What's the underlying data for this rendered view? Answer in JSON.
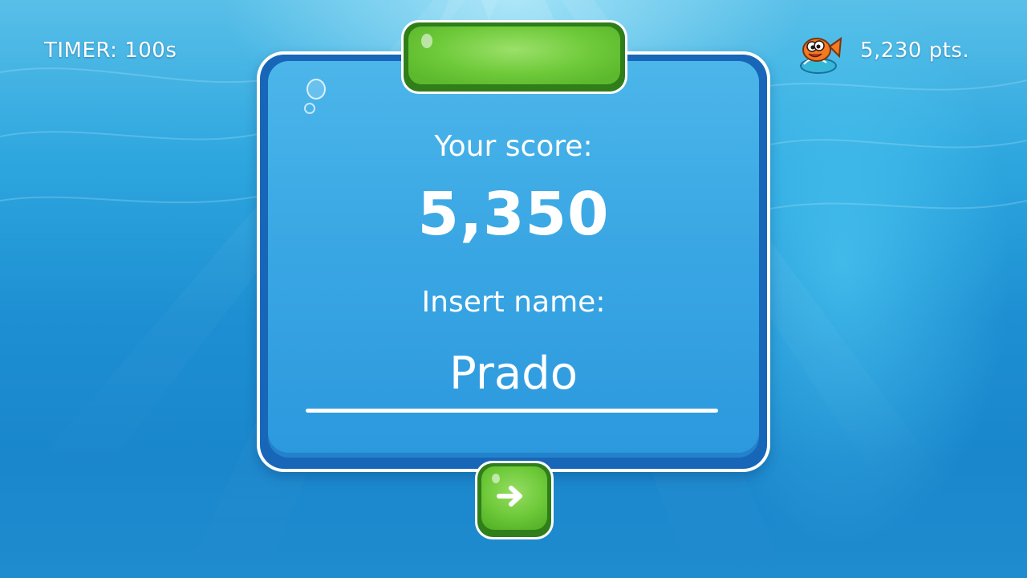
{
  "hud": {
    "timer_text": "TIMER: 100s",
    "points_text": "5,230 pts.",
    "points_icon": "fish-icon"
  },
  "dialog": {
    "score_label": "Your score:",
    "score_value": "5,350",
    "name_label": "Insert name:",
    "name_value": "Prado",
    "next_icon": "arrow-right-icon"
  },
  "colors": {
    "panel_blue": "#3aa7e4",
    "panel_border": "#1766b8",
    "button_green": "#6fca3a",
    "button_green_border": "#2f7e1a",
    "text": "#ffffff"
  }
}
